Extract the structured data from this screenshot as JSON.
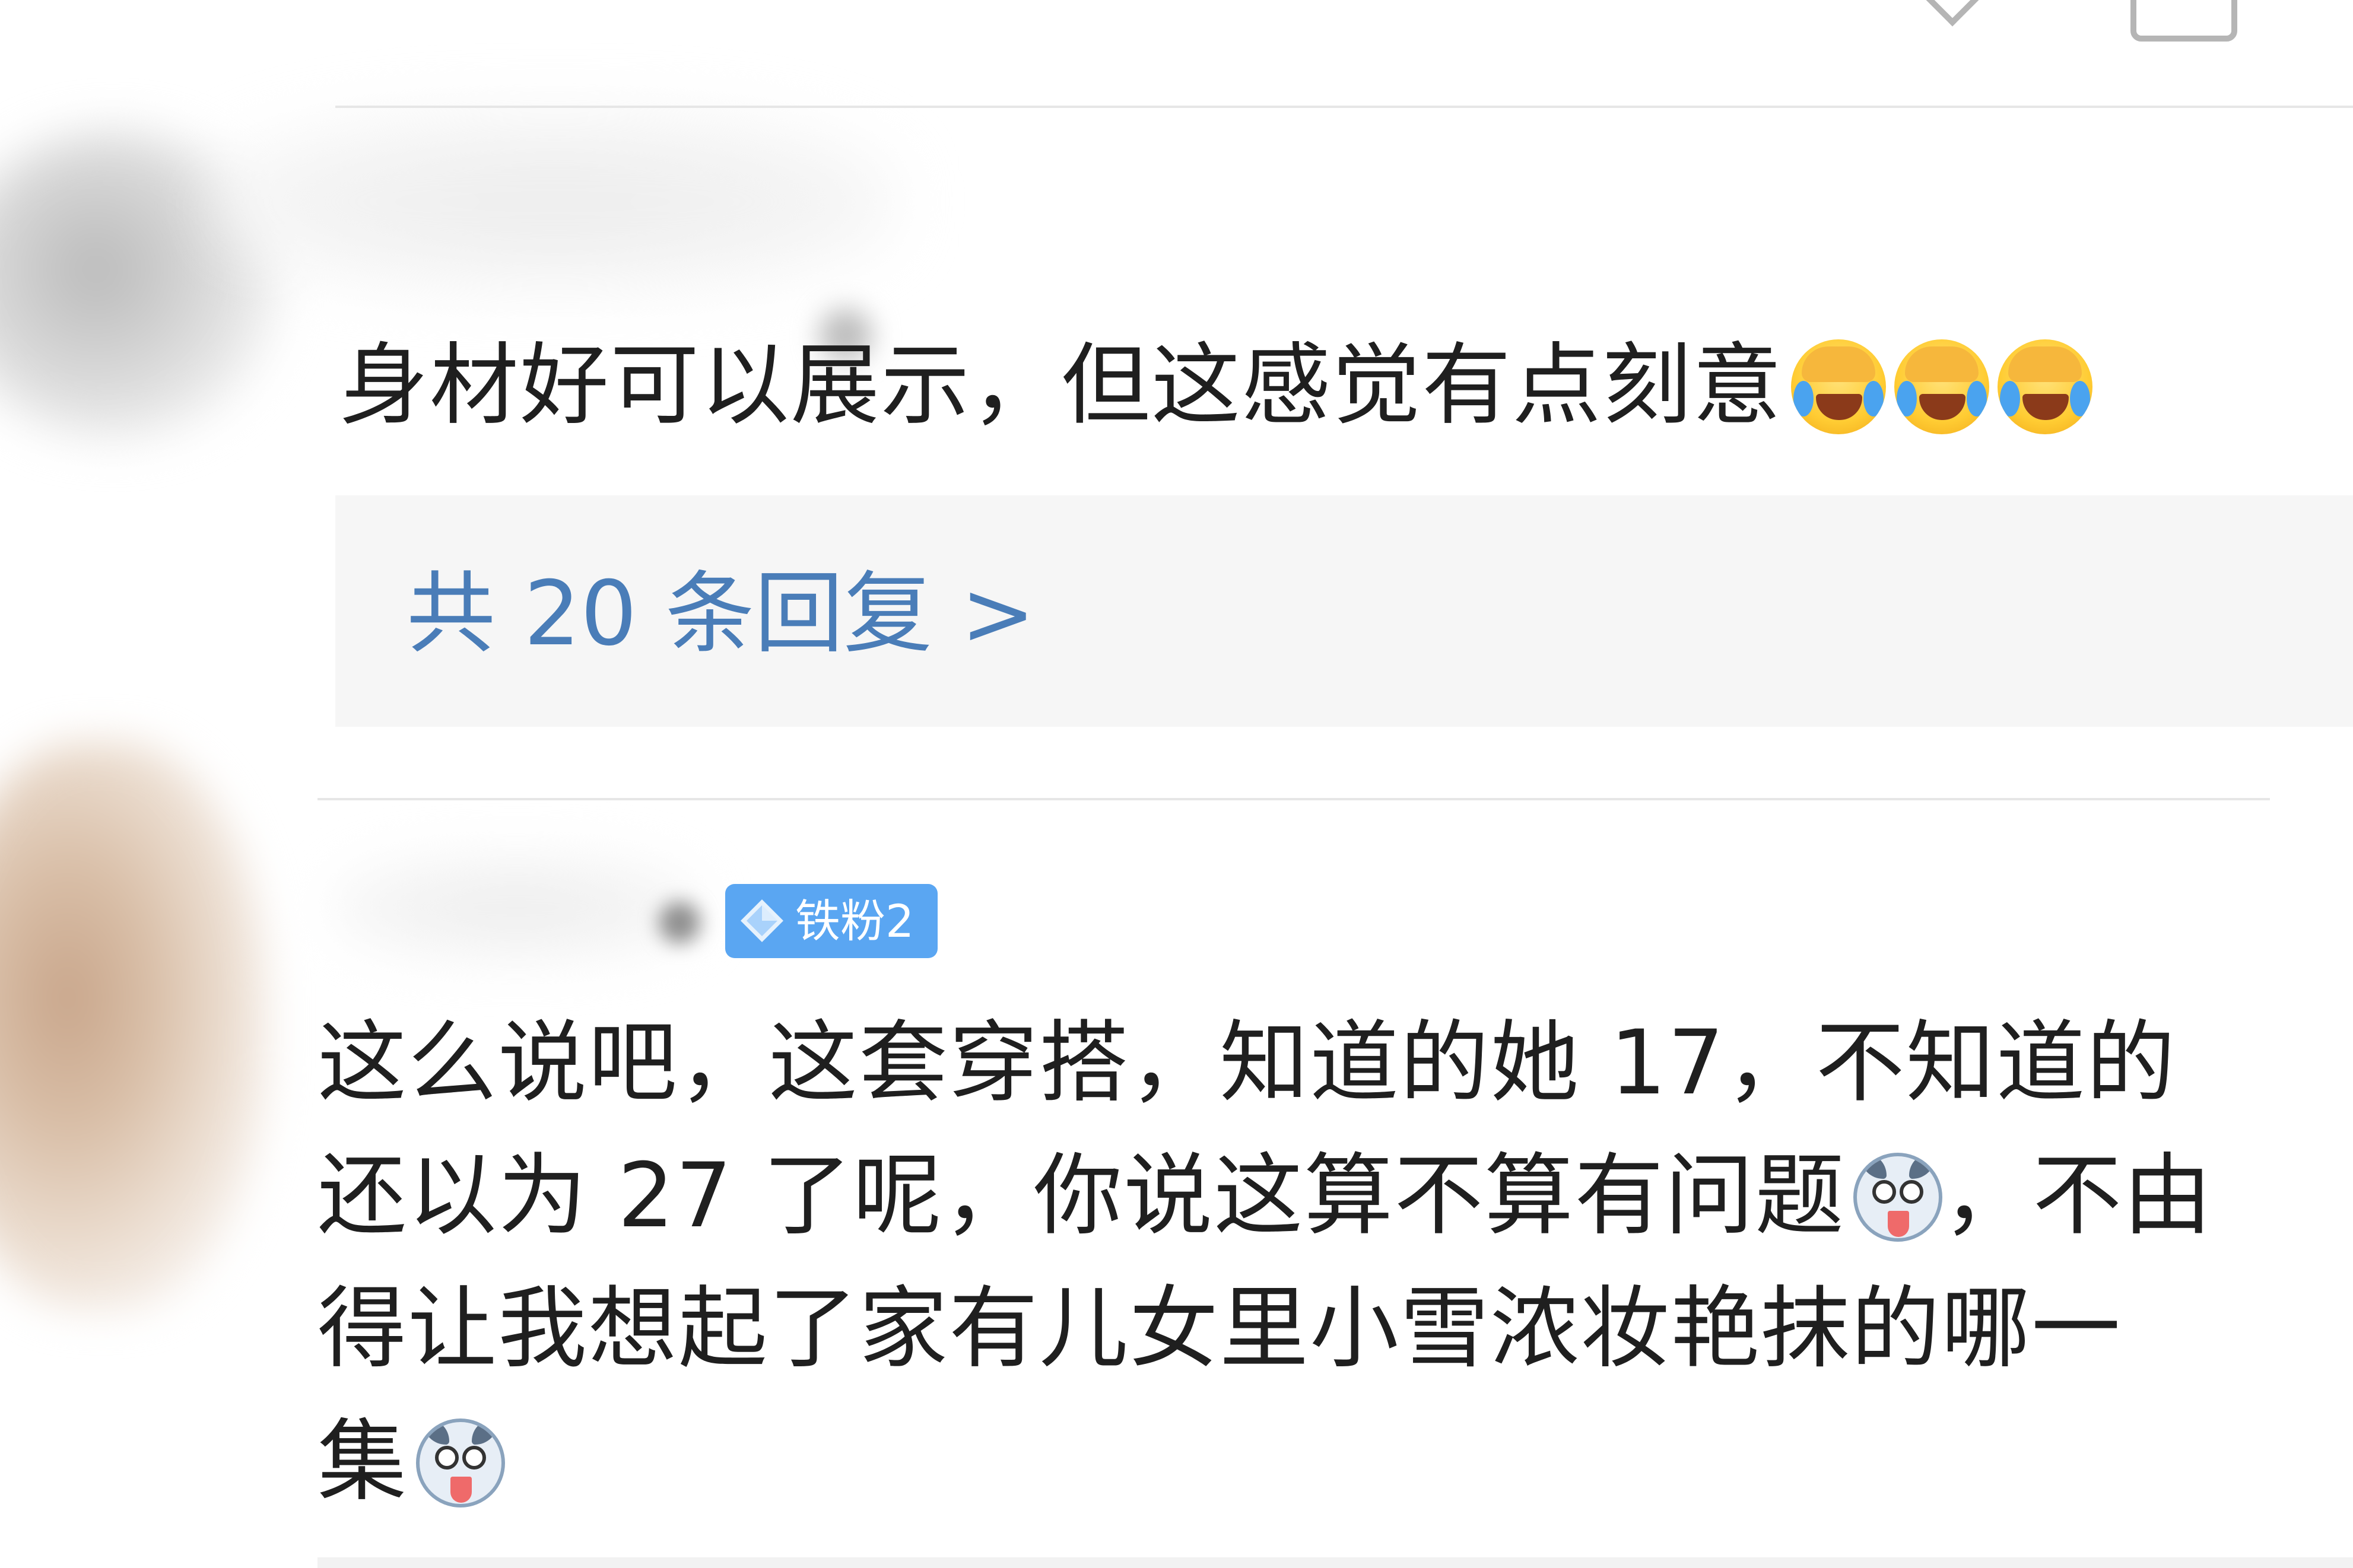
{
  "comment_1": {
    "text": "身材好可以展示，但这感觉有点刻意",
    "emojis": [
      "cover-face-laugh-cry-emoji",
      "cover-face-laugh-cry-emoji",
      "cover-face-laugh-cry-emoji"
    ]
  },
  "replies": {
    "label": "共 20 条回复 >"
  },
  "comment_2": {
    "badge": "铁粉2",
    "lines": [
      "这么说吧，这套穿搭，知道的她 17，不知道的",
      "还以为 27 了呢，你说这算不算有问题",
      "，不由",
      "得让我想起了家有儿女里小雪浓妆艳抹的哪一",
      "集"
    ],
    "emojis": [
      "husky-dog-emoji",
      "husky-dog-emoji"
    ]
  },
  "colors": {
    "link": "#4a7db8",
    "badge_bg": "#5aa6f2",
    "reply_box_bg": "#f6f6f6",
    "text": "#1f1f1f"
  }
}
